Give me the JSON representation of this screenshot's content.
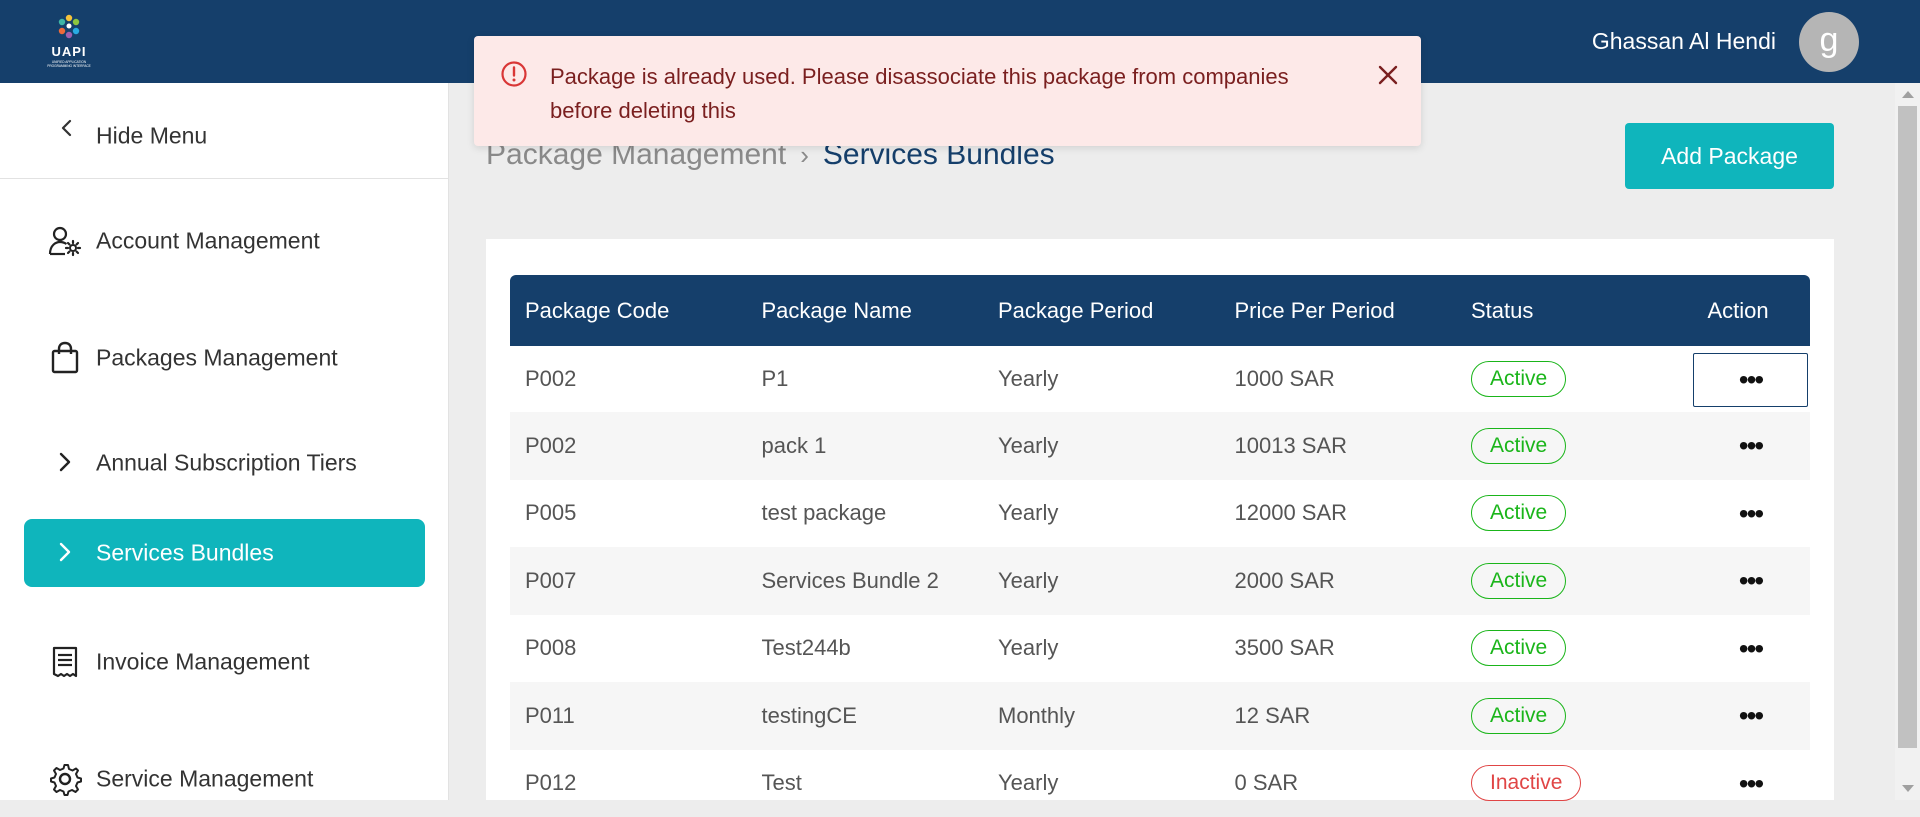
{
  "header": {
    "logo_text": "UAPI",
    "logo_subtitle": "UNIFIED APPLICATION PROGRAMMING INTERFACE",
    "user_name": "Ghassan Al Hendi",
    "avatar_initial": "g",
    "background_color": "#153f6b"
  },
  "toast": {
    "message": "Package is already used. Please disassociate this package from companies before deleting this",
    "icon": "warning-circle-icon",
    "close_icon": "close-icon"
  },
  "sidebar": {
    "hide_menu_label": "Hide Menu",
    "items": [
      {
        "label": "Account Management",
        "icon": "user-gear-icon",
        "active": false
      },
      {
        "label": "Packages Management",
        "icon": "shopping-bag-icon",
        "active": false
      },
      {
        "label": "Annual Subscription Tiers",
        "icon": "chevron-right-icon",
        "active": false
      },
      {
        "label": "Services Bundles",
        "icon": "chevron-right-icon",
        "active": true
      },
      {
        "label": "Invoice Management",
        "icon": "receipt-icon",
        "active": false
      },
      {
        "label": "Service Management",
        "icon": "gear-icon",
        "active": false
      }
    ]
  },
  "breadcrumb": {
    "parent": "Package Management",
    "current": "Services Bundles"
  },
  "actions": {
    "add_package_label": "Add Package"
  },
  "table": {
    "columns": [
      "Package Code",
      "Package Name",
      "Package Period",
      "Price Per Period",
      "Status",
      "Action"
    ],
    "rows": [
      {
        "code": "P002",
        "name": "P1",
        "period": "Yearly",
        "price": "1000 SAR",
        "status": "Active"
      },
      {
        "code": "P002",
        "name": "pack 1",
        "period": "Yearly",
        "price": "10013 SAR",
        "status": "Active"
      },
      {
        "code": "P005",
        "name": "test package",
        "period": "Yearly",
        "price": "12000 SAR",
        "status": "Active"
      },
      {
        "code": "P007",
        "name": "Services Bundle 2",
        "period": "Yearly",
        "price": "2000 SAR",
        "status": "Active"
      },
      {
        "code": "P008",
        "name": "Test244b",
        "period": "Yearly",
        "price": "3500 SAR",
        "status": "Active"
      },
      {
        "code": "P011",
        "name": "testingCE",
        "period": "Monthly",
        "price": "12 SAR",
        "status": "Active"
      },
      {
        "code": "P012",
        "name": "Test",
        "period": "Yearly",
        "price": "0 SAR",
        "status": "Inactive"
      }
    ]
  },
  "colors": {
    "accent": "#0fb5bc",
    "primary": "#153f6b",
    "active_status": "#1ab51a",
    "inactive_status": "#e04545",
    "toast_bg": "#fde9e8"
  }
}
